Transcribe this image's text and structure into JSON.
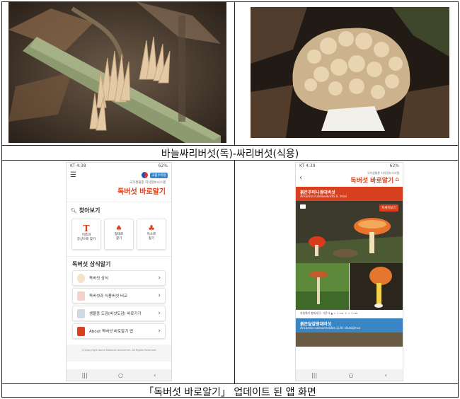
{
  "captions": {
    "top": "바늘싸리버섯(독)-싸리버섯(식용)",
    "bottom": "「독버섯 바로알기」 업데이트 된 앱 화면"
  },
  "left_phone": {
    "status_left": "KT 4:38",
    "status_right": "62%",
    "org": "국가생물종 지식정보시스템",
    "badge": "국립수목원",
    "title": "독버섯 바로알기",
    "search_heading": "찾아보기",
    "search_buttons": [
      {
        "label": "이름과\n증상으로 찾기",
        "glyph": "T"
      },
      {
        "label": "형태로\n찾기",
        "glyph": "🍄"
      },
      {
        "label": "독소로\n찾기",
        "glyph": "🍄"
      }
    ],
    "knowledge_heading": "독버섯 상식알기",
    "menu": [
      "독버섯 상식",
      "독버섯과 식용버섯 비교",
      "생물종 도감(버섯도감) 바로가기",
      "About 독버섯 바로알기 앱"
    ],
    "copyright": "(C)Copyright Korea National Arboretum. All Rights Reserved"
  },
  "right_phone": {
    "status_left": "KT 4:39",
    "status_right": "62%",
    "org": "국가생물종 지식정보시스템",
    "title": "독버섯 바로알기",
    "species1_name": "붉은주머니광대버섯",
    "species1_sci": "Amanita rubrovolvata S. Imai",
    "detail_button": "자세히보기",
    "caption_note": "자실체의 형태사진: 기준자 ▲ = 1 cm, C = 1 cm",
    "species2_name": "붉은달걀광대버섯",
    "species2_sci": "Amanita caesareoides Lj.N. Vassiljeva"
  },
  "colors": {
    "accent_red": "#d9401f",
    "accent_blue": "#3a86c5"
  }
}
